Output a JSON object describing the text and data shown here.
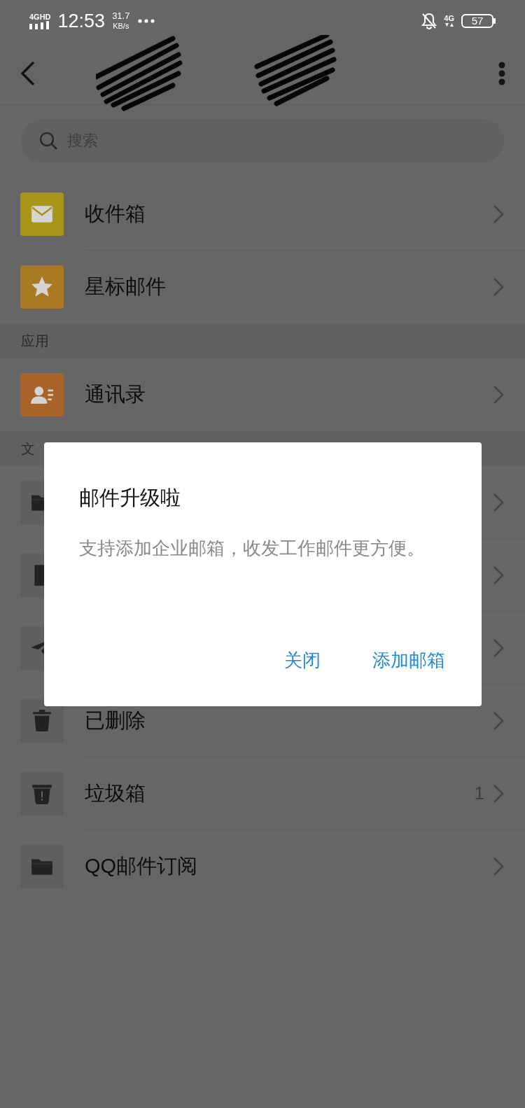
{
  "status_bar": {
    "network": "4GHD",
    "time": "12:53",
    "speed": "31.7",
    "speed_unit": "KB/s",
    "mobile": "4G",
    "battery": "57"
  },
  "search": {
    "placeholder": "搜索"
  },
  "sections": [
    {
      "items": [
        {
          "kind": "inbox",
          "label": "收件箱",
          "color": "#a8951a"
        },
        {
          "kind": "starred",
          "label": "星标邮件",
          "color": "#aa7a22"
        }
      ]
    },
    {
      "header": "应用",
      "items": [
        {
          "kind": "contacts",
          "label": "通讯录",
          "color": "#a86428"
        }
      ]
    },
    {
      "header": "文",
      "items": [
        {
          "kind": "folder"
        },
        {
          "kind": "file"
        },
        {
          "kind": "sent"
        },
        {
          "kind": "trash",
          "label": "已删除"
        },
        {
          "kind": "spam",
          "label": "垃圾箱",
          "count": "1"
        },
        {
          "kind": "folder",
          "label": "QQ邮件订阅"
        }
      ]
    }
  ],
  "dialog": {
    "title": "邮件升级啦",
    "message": "支持添加企业邮箱，收发工作邮件更方便。",
    "buttons": [
      "关闭",
      "添加邮箱"
    ]
  }
}
